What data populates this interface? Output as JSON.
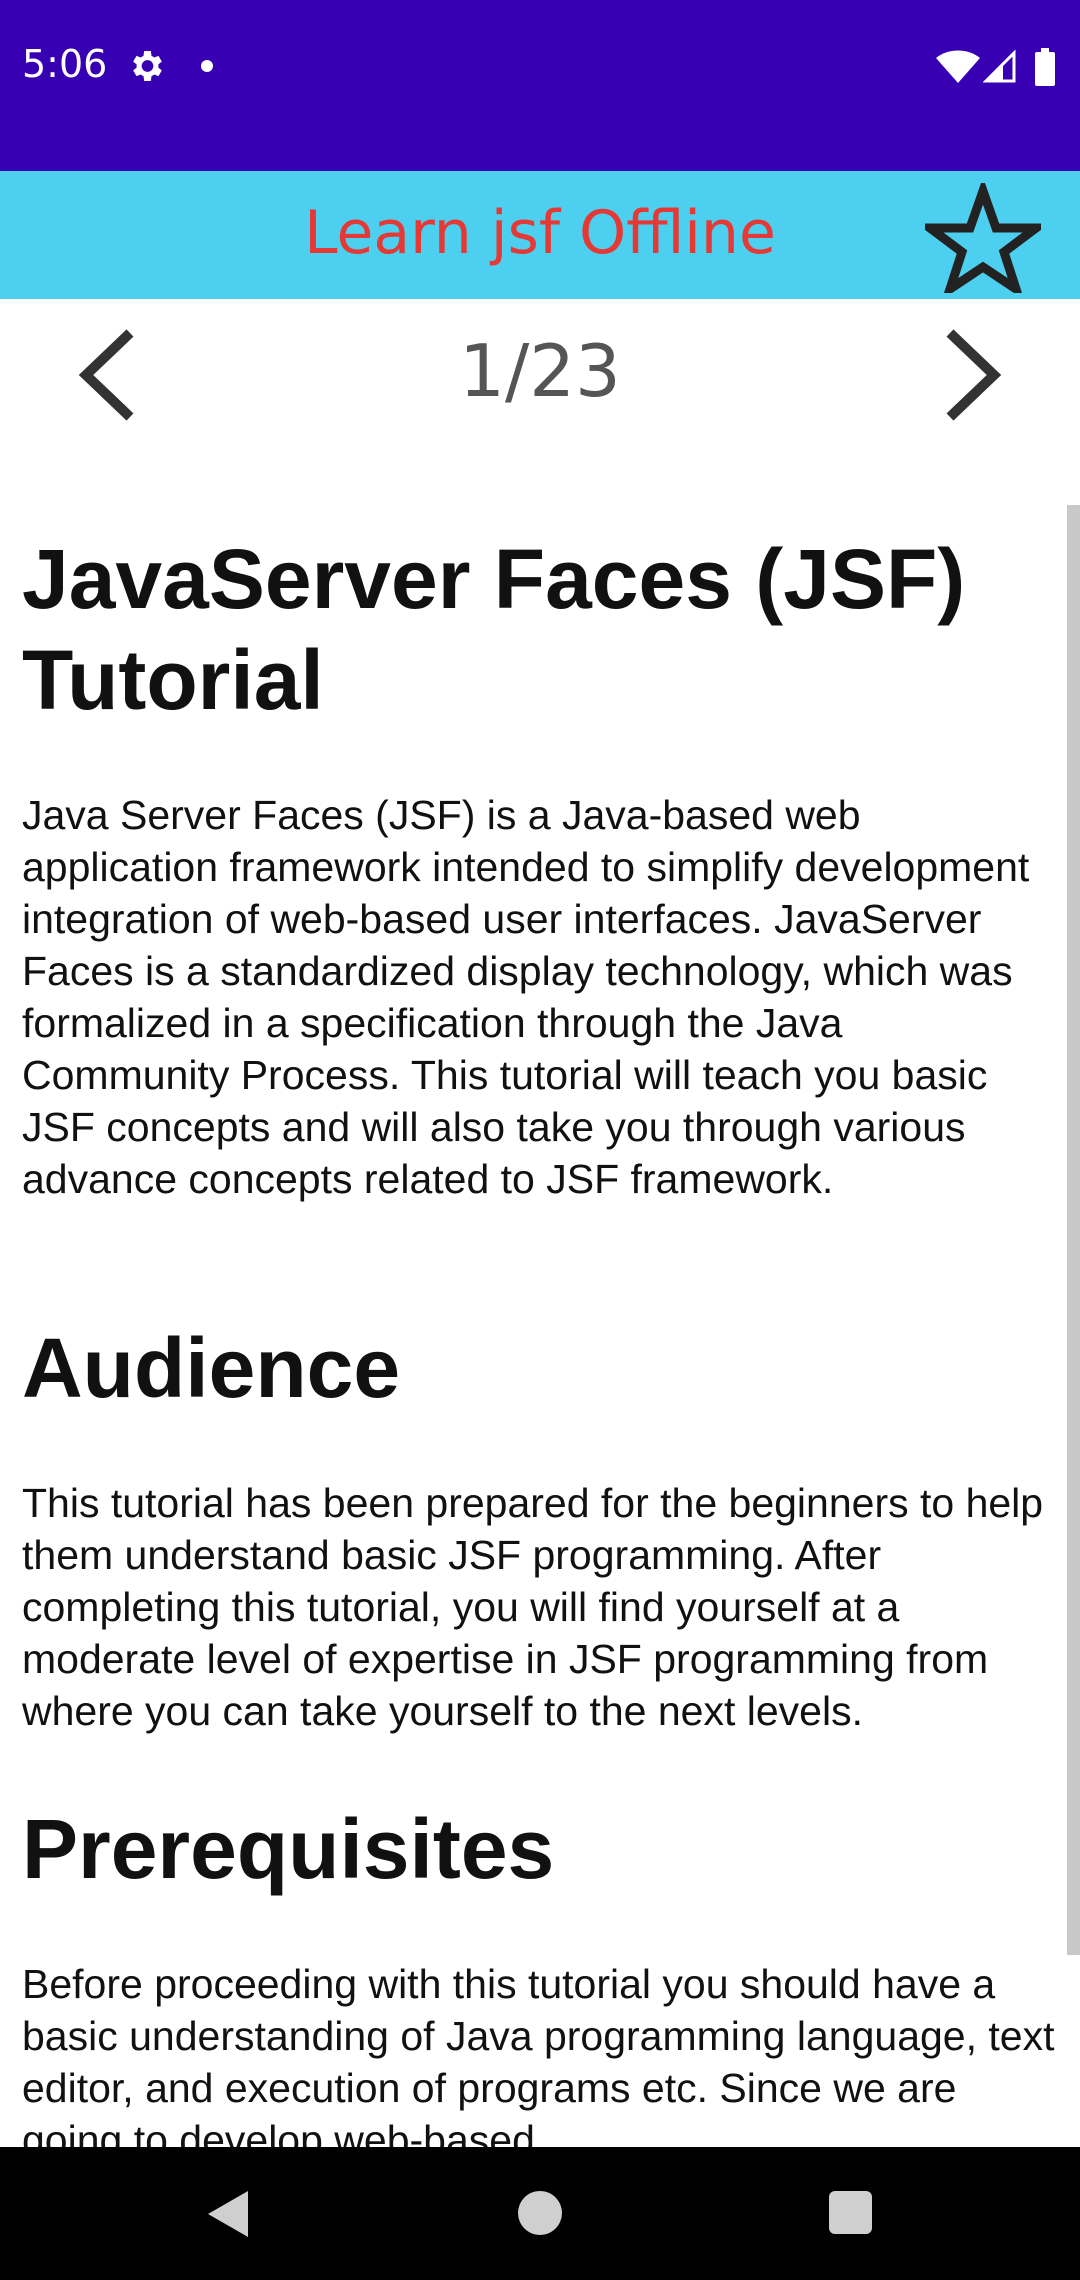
{
  "status_bar": {
    "time": "5:06",
    "icons": [
      "gear-icon",
      "notification-dot-icon",
      "wifi-icon",
      "signal-icon",
      "battery-icon"
    ]
  },
  "app_bar": {
    "title": "Learn jsf Offline",
    "favorite_icon": "star-outline-icon"
  },
  "pager": {
    "counter": "1/23",
    "prev_icon": "chevron-left-icon",
    "next_icon": "chevron-right-icon"
  },
  "article": {
    "title": "JavaServer Faces (JSF) Tutorial",
    "intro": "Java Server Faces (JSF) is a Java-based web application framework intended to simplify development integration of web-based user interfaces. JavaServer Faces is a standardized display technology, which was formalized in a specification through the Java Community Process. This tutorial will teach you basic JSF concepts and will also take you through various advance concepts related to JSF framework.",
    "audience_heading": "Audience",
    "audience_text": "This tutorial has been prepared for the beginners to help them understand basic JSF programming. After completing this tutorial, you will find yourself at a moderate level of expertise in JSF programming from where you can take yourself to the next levels.",
    "prerequisites_heading": "Prerequisites",
    "prerequisites_text": "Before proceeding with this tutorial you should have a basic understanding of Java programming language, text editor, and execution of programs etc. Since we are going to develop web-based"
  },
  "nav_bar": {
    "icons": [
      "back-icon",
      "home-icon",
      "recents-icon"
    ]
  },
  "colors": {
    "status_bar": "#3700b3",
    "app_bar": "#4dd0f0",
    "title_text": "#e53935"
  }
}
